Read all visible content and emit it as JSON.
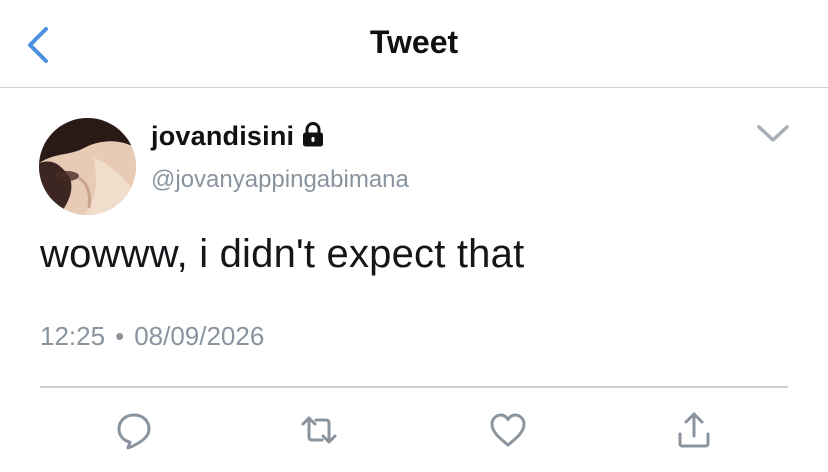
{
  "navbar": {
    "title": "Tweet",
    "back_icon": "chevron-left-icon",
    "accent_color": "#4a90e2"
  },
  "tweet": {
    "display_name": "jovandisini",
    "protected_icon": "lock-icon",
    "handle": "@jovanyappingabimana",
    "text": "wowww, i didn't expect that",
    "time": "12:25",
    "separator": "•",
    "date": "08/09/2026",
    "menu_icon": "chevron-down-icon"
  },
  "actions": [
    {
      "name": "reply",
      "icon": "reply-icon"
    },
    {
      "name": "retweet",
      "icon": "retweet-icon"
    },
    {
      "name": "like",
      "icon": "heart-icon"
    },
    {
      "name": "share",
      "icon": "share-icon"
    }
  ],
  "colors": {
    "text": "#14171a",
    "secondary_text": "#8a949e",
    "icon_gray": "#8a949e",
    "divider": "#cfcfd2"
  }
}
